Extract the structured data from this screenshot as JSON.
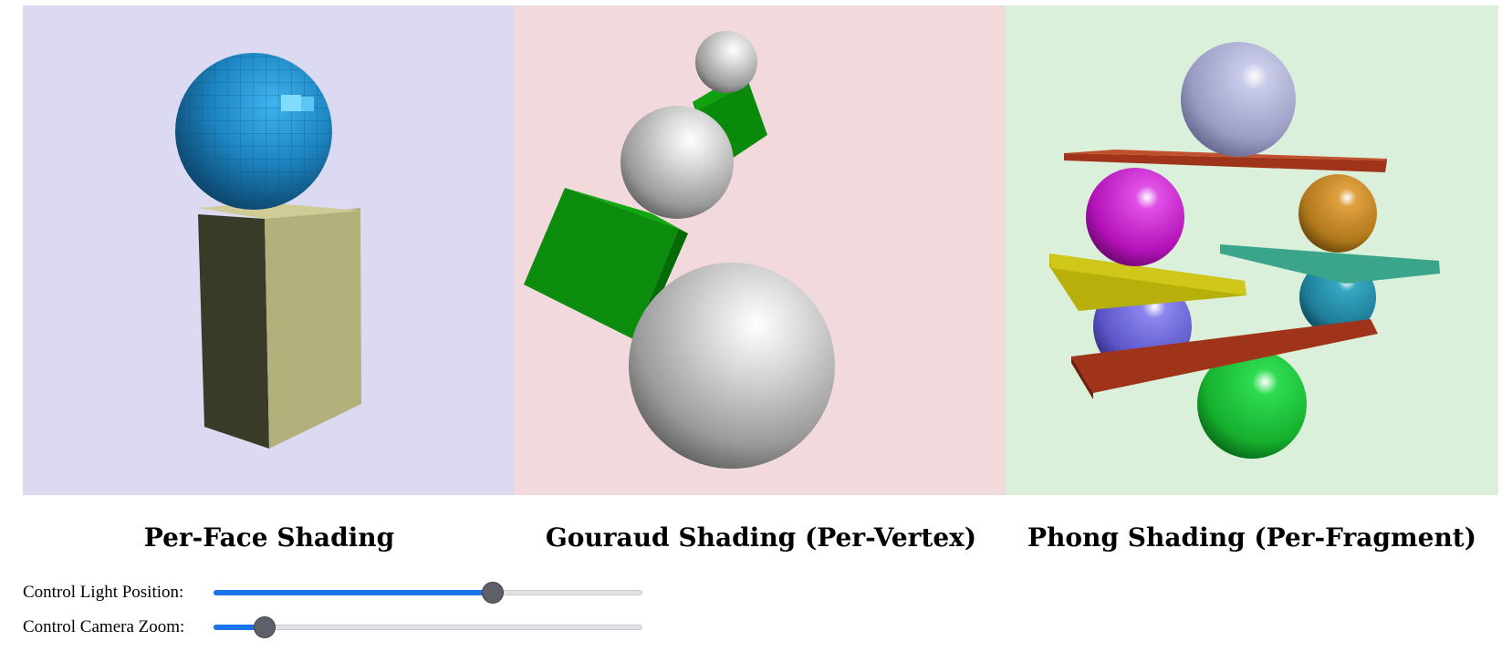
{
  "panels": [
    {
      "caption": "Per-Face Shading",
      "background": "#dcdaf2"
    },
    {
      "caption": "Gouraud Shading (Per-Vertex)",
      "background": "#f2dadc"
    },
    {
      "caption": "Phong Shading (Per-Fragment)",
      "background": "#daf0da"
    }
  ],
  "controls": {
    "light": {
      "label": "Control Light Position:",
      "value": 0.65
    },
    "zoom": {
      "label": "Control Camera Zoom:",
      "value": 0.12
    }
  },
  "colors": {
    "slider_accent": "#1a73e8",
    "slider_thumb": "#5d6068"
  }
}
